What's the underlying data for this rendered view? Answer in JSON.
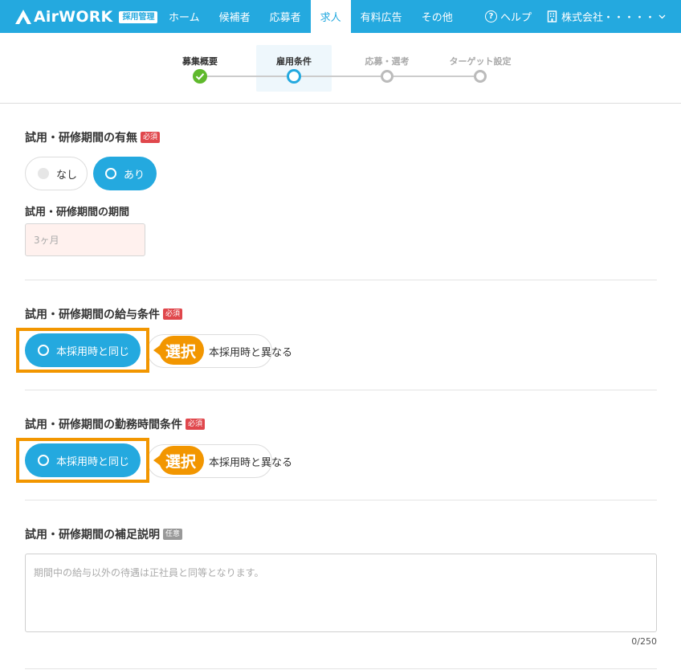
{
  "header": {
    "logo_text": "AirWORK",
    "logo_badge": "採用管理",
    "nav": [
      "ホーム",
      "候補者",
      "応募者",
      "求人",
      "有料広告",
      "その他"
    ],
    "active_nav": "求人",
    "help_label": "ヘルプ",
    "help_glyph": "?",
    "company_label": "株式会社・・・・・",
    "accent_color": "#24a9df"
  },
  "stepper": {
    "steps": [
      {
        "label": "募集概要",
        "state": "done"
      },
      {
        "label": "雇用条件",
        "state": "current"
      },
      {
        "label": "応募・選考",
        "state": "pending"
      },
      {
        "label": "ターゲット設定",
        "state": "pending"
      }
    ]
  },
  "form": {
    "trial_period": {
      "label": "試用・研修期間の有無",
      "tag": "必須",
      "options": [
        "なし",
        "あり"
      ],
      "selected": "あり"
    },
    "trial_duration": {
      "label": "試用・研修期間の期間",
      "placeholder": "3ヶ月"
    },
    "salary_condition": {
      "label": "試用・研修期間の給与条件",
      "tag": "必須",
      "options": [
        "本採用時と同じ",
        "本採用時と異なる"
      ],
      "selected": "本採用時と同じ",
      "callout": "選択"
    },
    "work_hours_condition": {
      "label": "試用・研修期間の勤務時間条件",
      "tag": "必須",
      "options": [
        "本採用時と同じ",
        "本採用時と異なる"
      ],
      "selected": "本採用時と同じ",
      "callout": "選択"
    },
    "supplement": {
      "label": "試用・研修期間の補足説明",
      "tag": "任意",
      "placeholder": "期間中の給与以外の待遇は正社員と同等となります。",
      "counter": "0/250"
    }
  },
  "colors": {
    "highlight": "#f29600",
    "required_tag": "#e0474c",
    "optional_tag": "#999999",
    "done_step": "#5fb92c"
  }
}
